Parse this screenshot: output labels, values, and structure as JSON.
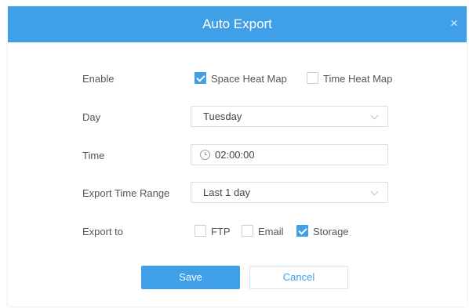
{
  "dialog": {
    "title": "Auto Export",
    "close_symbol": "×"
  },
  "enable": {
    "label": "Enable",
    "options": [
      {
        "label": "Space Heat Map",
        "checked": true
      },
      {
        "label": "Time Heat Map",
        "checked": false
      }
    ]
  },
  "day": {
    "label": "Day",
    "value": "Tuesday"
  },
  "time": {
    "label": "Time",
    "value": "02:00:00",
    "icon": "clock-icon"
  },
  "export_time_range": {
    "label": "Export Time Range",
    "value": "Last 1 day"
  },
  "export_to": {
    "label": "Export to",
    "options": [
      {
        "label": "FTP",
        "checked": false
      },
      {
        "label": "Email",
        "checked": false
      },
      {
        "label": "Storage",
        "checked": true
      }
    ]
  },
  "buttons": {
    "save": "Save",
    "cancel": "Cancel"
  },
  "colors": {
    "accent": "#3f9fe7",
    "header_text": "#ffffff"
  }
}
